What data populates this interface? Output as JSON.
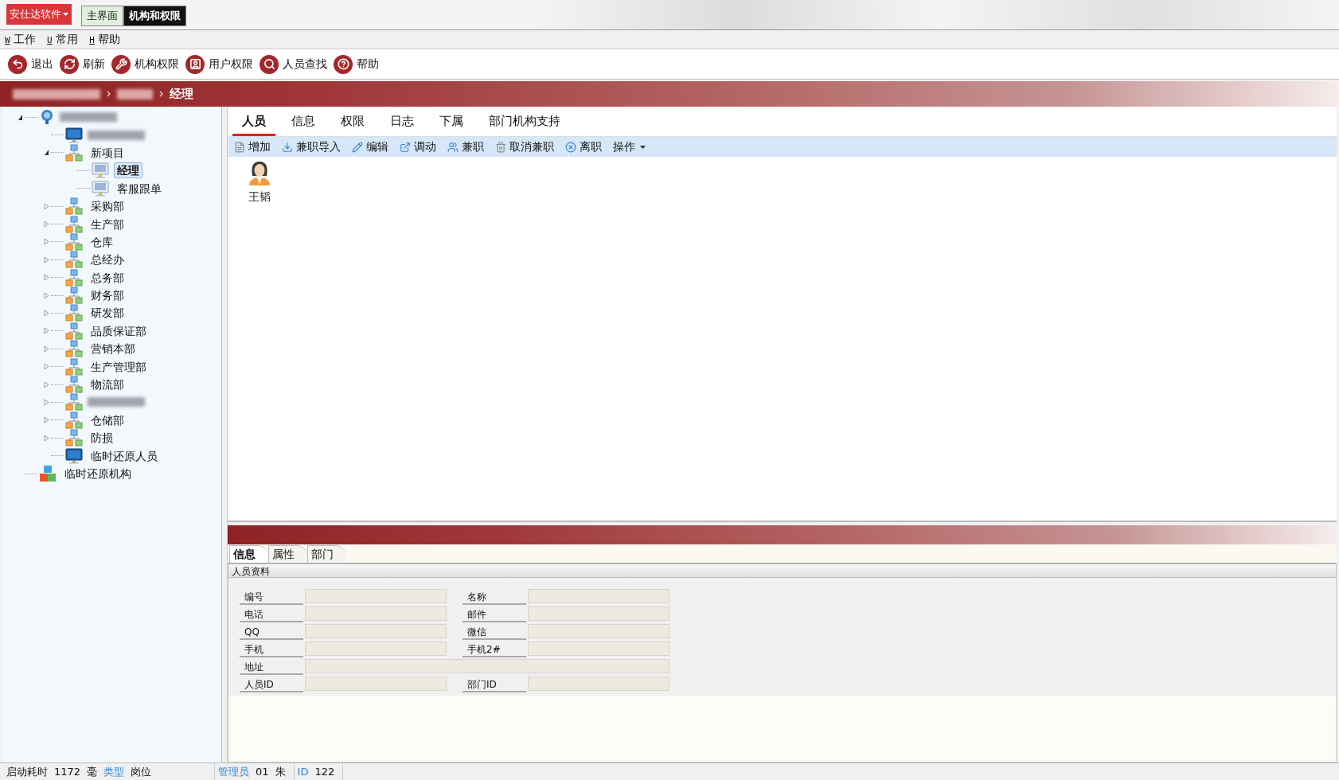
{
  "app_menu": {
    "label": "安仕达软件"
  },
  "window_tabs": [
    {
      "label": "主界面",
      "selected": false
    },
    {
      "label": "机构和权限",
      "selected": true
    }
  ],
  "menu": [
    {
      "key": "W",
      "label": "工作"
    },
    {
      "key": "U",
      "label": "常用"
    },
    {
      "key": "H",
      "label": "帮助"
    }
  ],
  "toolbar": [
    {
      "kind": "exit",
      "label": "退出"
    },
    {
      "kind": "refresh",
      "label": "刷新"
    },
    {
      "kind": "tools",
      "label": "机构权限"
    },
    {
      "kind": "user",
      "label": "用户权限"
    },
    {
      "kind": "search",
      "label": "人员查找"
    },
    {
      "kind": "help",
      "label": "帮助"
    }
  ],
  "breadcrumb": [
    {
      "blurred": true
    },
    {
      "blurred": true
    },
    {
      "label": "经理"
    }
  ],
  "tree": [
    {
      "kind": "root",
      "blurred": true,
      "expanded": true,
      "children": [
        {
          "kind": "screen",
          "blurred": true
        },
        {
          "kind": "dept",
          "label": "新项目",
          "expanded": true,
          "children": [
            {
              "kind": "post",
              "label": "经理",
              "selected": true
            },
            {
              "kind": "post",
              "label": "客服跟单",
              "selected": false
            }
          ]
        },
        {
          "kind": "dept",
          "label": "采购部",
          "expanded": false
        },
        {
          "kind": "dept",
          "label": "生产部",
          "expanded": false
        },
        {
          "kind": "dept",
          "label": "仓库",
          "expanded": false
        },
        {
          "kind": "dept",
          "label": "总经办",
          "expanded": false
        },
        {
          "kind": "dept",
          "label": "总务部",
          "expanded": false
        },
        {
          "kind": "dept",
          "label": "财务部",
          "expanded": false
        },
        {
          "kind": "dept",
          "label": "研发部",
          "expanded": false
        },
        {
          "kind": "dept",
          "label": "品质保证部",
          "expanded": false
        },
        {
          "kind": "dept",
          "label": "营销本部",
          "expanded": false
        },
        {
          "kind": "dept",
          "label": "生产管理部",
          "expanded": false
        },
        {
          "kind": "dept",
          "label": "物流部",
          "expanded": false
        },
        {
          "kind": "dept",
          "blurred": true,
          "expanded": false
        },
        {
          "kind": "dept",
          "label": "仓储部",
          "expanded": false
        },
        {
          "kind": "dept",
          "label": "防损",
          "expanded": false
        },
        {
          "kind": "screen",
          "label": "临时还原人员"
        }
      ]
    },
    {
      "kind": "cubes",
      "label": "临时还原机构"
    }
  ],
  "tabs": [
    {
      "label": "人员",
      "selected": true
    },
    {
      "label": "信息",
      "selected": false
    },
    {
      "label": "权限",
      "selected": false
    },
    {
      "label": "日志",
      "selected": false
    },
    {
      "label": "下属",
      "selected": false
    },
    {
      "label": "部门机构支持",
      "selected": false
    }
  ],
  "actions": [
    {
      "kind": "add",
      "label": "增加"
    },
    {
      "kind": "import",
      "label": "兼职导入"
    },
    {
      "kind": "edit",
      "label": "编辑"
    },
    {
      "kind": "move",
      "label": "调动"
    },
    {
      "kind": "parttime",
      "label": "兼职"
    },
    {
      "kind": "delete",
      "label": "取消兼职"
    },
    {
      "kind": "leave",
      "label": "离职"
    },
    {
      "kind": "dropdown",
      "label": "操作"
    }
  ],
  "people": [
    {
      "name": "王韬"
    }
  ],
  "detail_tabs": [
    {
      "label": "信息",
      "selected": true
    },
    {
      "label": "属性",
      "selected": false
    },
    {
      "label": "部门",
      "selected": false
    }
  ],
  "section_title": "人员资料",
  "form_rows": [
    [
      {
        "label": "编号"
      },
      {
        "label": "名称"
      }
    ],
    [
      {
        "label": "电话"
      },
      {
        "label": "邮件"
      }
    ],
    [
      {
        "label": "QQ"
      },
      {
        "label": "微信"
      }
    ],
    [
      {
        "label": "手机"
      },
      {
        "label": "手机2#"
      }
    ],
    [
      {
        "label": "地址",
        "wide": true
      }
    ],
    [
      {
        "label": "人员ID"
      },
      {
        "label": "部门ID"
      }
    ]
  ],
  "status_bar": [
    [
      {
        "kind": "text",
        "text": "启动耗时"
      },
      {
        "kind": "text",
        "text": "1172"
      },
      {
        "kind": "text",
        "text": "毫"
      },
      {
        "kind": "label",
        "text": "类型"
      },
      {
        "kind": "text",
        "text": "岗位"
      }
    ],
    [
      {
        "kind": "label",
        "text": "管理员"
      },
      {
        "kind": "text",
        "text": "01"
      },
      {
        "kind": "text",
        "text": "朱"
      }
    ],
    [
      {
        "kind": "label",
        "text": "ID"
      },
      {
        "kind": "text",
        "text": "122"
      }
    ]
  ]
}
